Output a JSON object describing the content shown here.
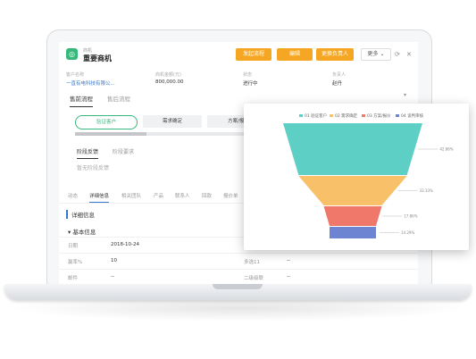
{
  "header": {
    "app_icon": "target-icon",
    "module": "商机",
    "record_title": "重要商机",
    "buttons": {
      "process": "发起流程",
      "edit": "编辑",
      "change_owner": "更换负责人",
      "more": "更多"
    },
    "icons": [
      "refresh-icon",
      "close-icon"
    ]
  },
  "info": {
    "customer": {
      "label": "客户名称",
      "value": "一直有电科技有限公..."
    },
    "amount": {
      "label": "商机金额(元)",
      "value": "800,000.00"
    },
    "status": {
      "label": "状态",
      "value": "进行中"
    },
    "owner": {
      "label": "负责人",
      "value": "赵丹"
    }
  },
  "process_tabs": [
    "售前流程",
    "售后流程"
  ],
  "stages": [
    "验证客户",
    "需求确定",
    "方案/报价"
  ],
  "feedback_tabs": [
    "阶段反馈",
    "阶段要求"
  ],
  "no_feedback": "暂无阶段反馈",
  "detail_tabs": [
    "动态",
    "详细信息",
    "相关团队",
    "产品",
    "联系人",
    "回款",
    "报价单"
  ],
  "detail_title": "详细信息",
  "basic_title": "基本信息",
  "fields": [
    {
      "label": "日期",
      "value": "2018-10-24",
      "label2": "",
      "value2": ""
    },
    {
      "label": "赢率%",
      "value": "10",
      "label2": "多选11",
      "value2": "--"
    },
    {
      "label": "邮件",
      "value": "--",
      "label2": "二级级联",
      "value2": "--"
    }
  ],
  "colors": {
    "accent_green": "#38b77b",
    "button_orange": "#f5a623",
    "link_blue": "#3a79c9"
  },
  "chart_data": {
    "type": "funnel",
    "legend": [
      "01 验证客户",
      "02 需求确定",
      "03 方案/报价",
      "04 谈判审核"
    ],
    "series_colors": [
      "#5ecfc5",
      "#f9c06a",
      "#f0786a",
      "#6c84d1"
    ],
    "values": [
      42.86,
      33.33,
      17.86,
      14.29
    ],
    "value_labels": [
      "42.86%",
      "33.33%",
      "17.86%",
      "14.29%"
    ]
  }
}
